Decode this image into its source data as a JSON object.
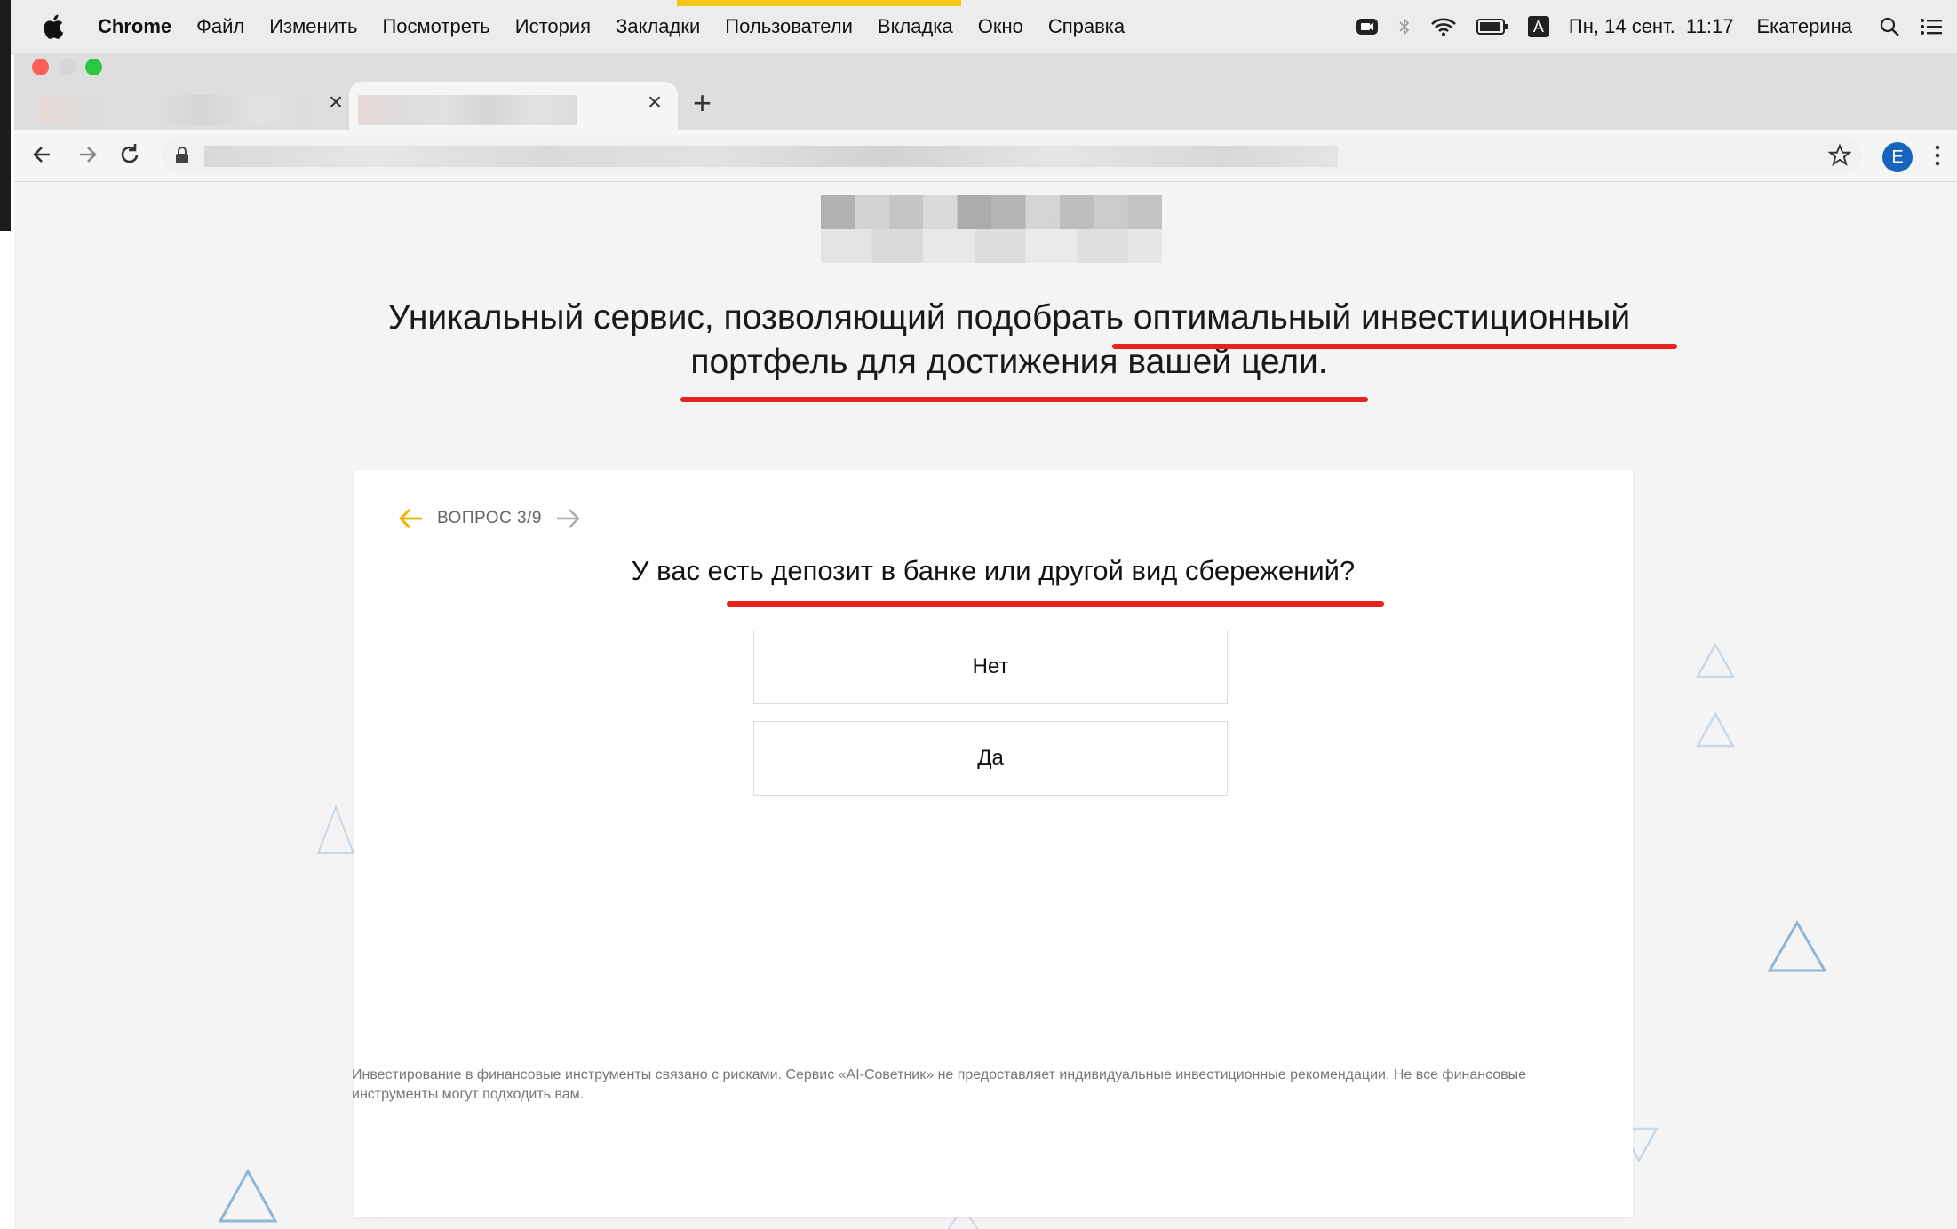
{
  "menubar": {
    "app": "Chrome",
    "items": [
      "Файл",
      "Изменить",
      "Посмотреть",
      "История",
      "Закладки",
      "Пользователи",
      "Вкладка",
      "Окно",
      "Справка"
    ],
    "input_source": "A",
    "datetime": "Пн, 14 сент.  11:17",
    "user": "Екатерина"
  },
  "browser": {
    "new_tab": "+",
    "avatar_letter": "E"
  },
  "page": {
    "headline_line1": "Уникальный сервис, позволяющий подобрать оптимальный инвестиционный",
    "headline_line2": "портфель для достижения вашей цели.",
    "question_counter": "ВОПРОС 3/9",
    "question": "У вас есть депозит в банке или другой вид сбережений?",
    "answers": [
      "Нет",
      "Да"
    ],
    "disclaimer": "Инвестирование в финансовые инструменты связано с рисками. Сервис «AI-Советник» не предоставляет индивидуальные инвестиционные рекомендации. Не все финансовые инструменты могут подходить вам."
  },
  "colors": {
    "accent": "#f0b400",
    "underline": "#e8221c",
    "triangle": "#8fb6d6"
  }
}
